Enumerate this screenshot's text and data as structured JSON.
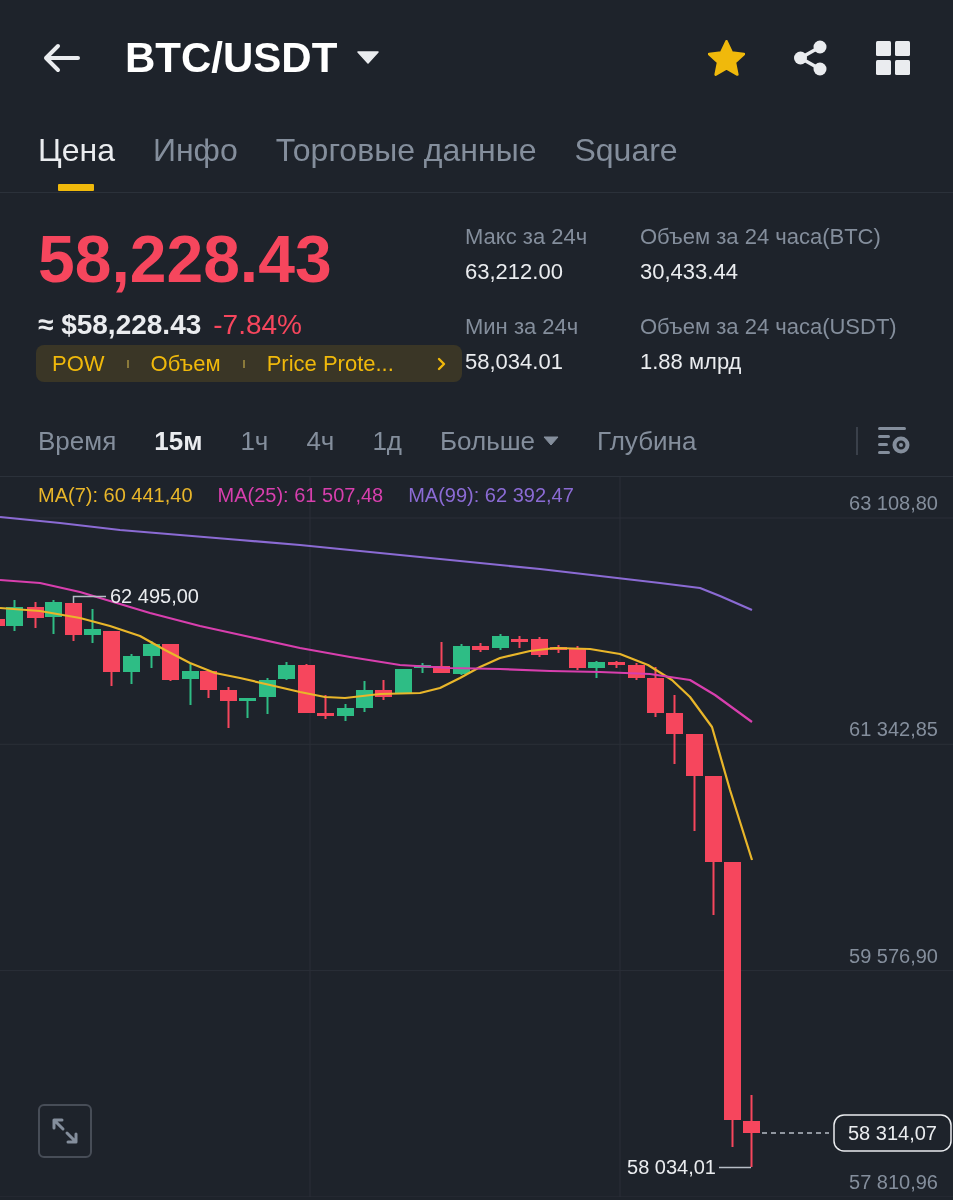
{
  "header": {
    "title": "BTC/USDT",
    "favorite": true
  },
  "tabs": [
    {
      "label": "Цена",
      "selected": true
    },
    {
      "label": "Инфо",
      "selected": false
    },
    {
      "label": "Торговые данные",
      "selected": false
    },
    {
      "label": "Square",
      "selected": false
    }
  ],
  "ticker": {
    "price": "58,228.43",
    "negative": true,
    "fiat_price": "≈ $58,228.43",
    "change": "-7.84%",
    "tags": [
      "POW",
      "Объем",
      "Price Prote..."
    ]
  },
  "stats": [
    {
      "label": "Макс за 24ч",
      "value": "63,212.00"
    },
    {
      "label": "Объем за 24 часа(BTC)",
      "value": "30,433.44"
    },
    {
      "label": "Мин за 24ч",
      "value": "58,034.01"
    },
    {
      "label": "Объем за 24 часа(USDT)",
      "value": "1.88 млрд"
    }
  ],
  "intervals": [
    {
      "label": "Время",
      "kind": "option",
      "selected": false
    },
    {
      "label": "15м",
      "kind": "option",
      "selected": true
    },
    {
      "label": "1ч",
      "kind": "option",
      "selected": false
    },
    {
      "label": "4ч",
      "kind": "option",
      "selected": false
    },
    {
      "label": "1д",
      "kind": "option",
      "selected": false
    },
    {
      "label": "Больше",
      "kind": "menu",
      "selected": false
    },
    {
      "label": "Глубина",
      "kind": "option",
      "selected": false
    }
  ],
  "chart": {
    "ma": [
      {
        "label": "MA(7): 60 441,40",
        "color": "#e9b62a"
      },
      {
        "label": "MA(25): 61 507,48",
        "color": "#d83fae"
      },
      {
        "label": "MA(99): 62 392,47",
        "color": "#8b6bd4"
      }
    ],
    "price_labels": [
      "63 108,80",
      "61 342,85",
      "59 576,90",
      "57 810,96"
    ],
    "high_label": "62 495,00",
    "low_label": "58 034,01",
    "last_price": "58 314,07"
  }
}
